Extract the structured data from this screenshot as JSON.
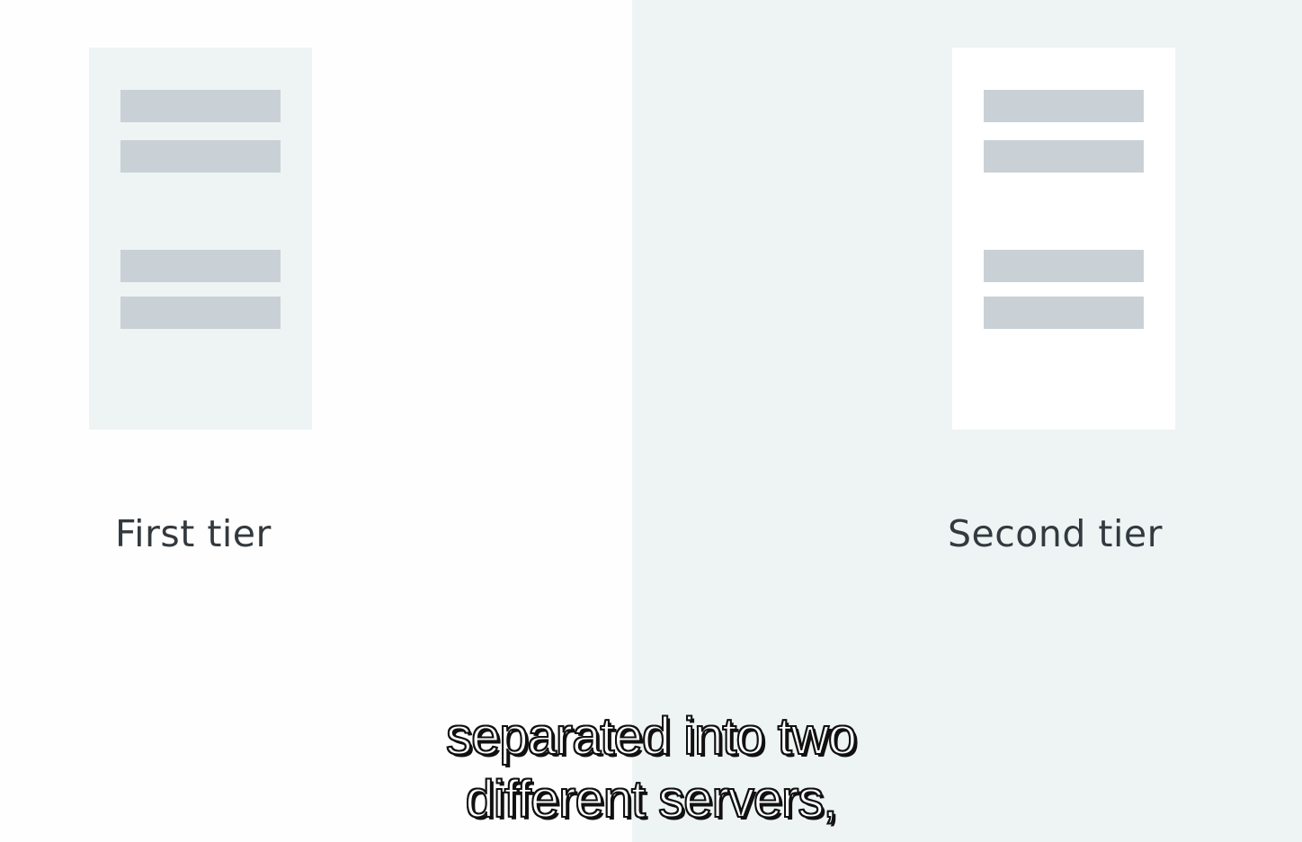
{
  "tiers": {
    "first": {
      "label": "First tier"
    },
    "second": {
      "label": "Second tier"
    }
  },
  "caption": {
    "line1": "separated into two",
    "line2": "different servers,"
  },
  "colors": {
    "left_background": "#fefefe",
    "right_background": "#eef4f4",
    "first_card": "#eef3f4",
    "second_card": "#ffffff",
    "placeholder_bar": "#c9d1d6",
    "label_text": "#333a3f"
  }
}
